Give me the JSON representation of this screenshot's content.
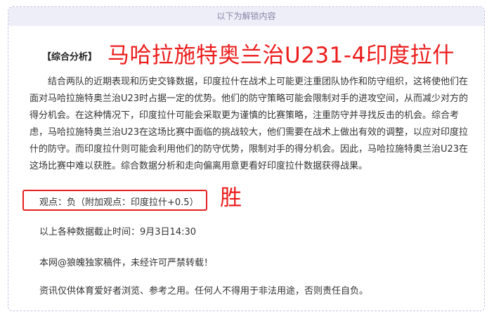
{
  "unlock_bar": {
    "label": "以下为解锁内容"
  },
  "headline": {
    "section_label": "【综合分析】",
    "overlay_title": "马哈拉施特奥兰治U231-4印度拉什"
  },
  "analysis": {
    "paragraph": "结合两队的近期表现和历史交锋数据，印度拉什在战术上可能更注重团队协作和防守组织，这将使他们在面对马哈拉施特奥兰治U23时占据一定的优势。他们的防守策略可能会限制对手的进攻空间，从而减少对方的得分机会。在这种情况下，印度拉什可能会采取更为谨慎的比赛策略，注重防守并寻找反击的机会。综合考虑，马哈拉施特奥兰治U23在这场比赛中面临的挑战较大，他们需要在战术上做出有效的调整，以应对印度拉什的防守。而印度拉什则可能会利用他们的防守优势，限制对手的得分机会。因此，马哈拉施特奥兰治U23在这场比赛中难以获胜。综合数据分析和走向偏离用意更看好印度拉什数据获得战果。"
  },
  "opinion": {
    "text": "观点：负（附加观点：印度拉什+0.5）",
    "result_mark": "胜"
  },
  "footer": {
    "data_cutoff": "以上各种数据截止时间：9月3日14:30",
    "copyright": "本网@狼魄独家稿件，未经许可严禁转载！",
    "disclaimer": "资讯仅供体育爱好者浏览、参考之用。任何人不得用于非法用途，否则责任自负。"
  },
  "colors": {
    "accent_red": "#ec1c1c",
    "unlock_bar_bg": "#eeeef8",
    "card_border": "#c9c3e3"
  }
}
